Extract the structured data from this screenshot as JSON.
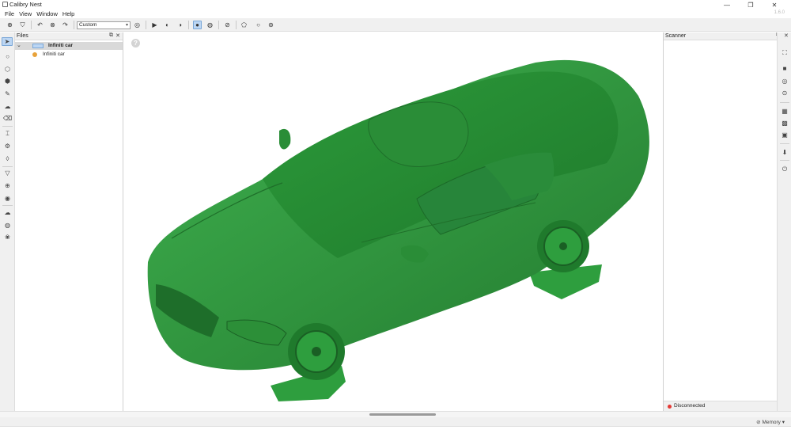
{
  "window": {
    "title": "Calibry Nest",
    "version": "1.6.0",
    "controls": {
      "minimize": "—",
      "restore": "❐",
      "close": "✕"
    }
  },
  "menu": [
    "File",
    "View",
    "Window",
    "Help"
  ],
  "toolbar": {
    "view_mode": "Custom"
  },
  "files_panel": {
    "title": "Files",
    "items": [
      {
        "label": "Infiniti car",
        "type": "group",
        "selected": true
      },
      {
        "label": "Infiniti car",
        "type": "scan"
      }
    ]
  },
  "scanner_panel": {
    "title": "Scanner",
    "status": "Disconnected",
    "status_color": "#e53935"
  },
  "statusbar": {
    "memory_label": "Memory"
  },
  "colors": {
    "model_green": "#2e9e3e",
    "accent_blue": "#bcd6f3",
    "scan_dot": "#e8a23a"
  }
}
